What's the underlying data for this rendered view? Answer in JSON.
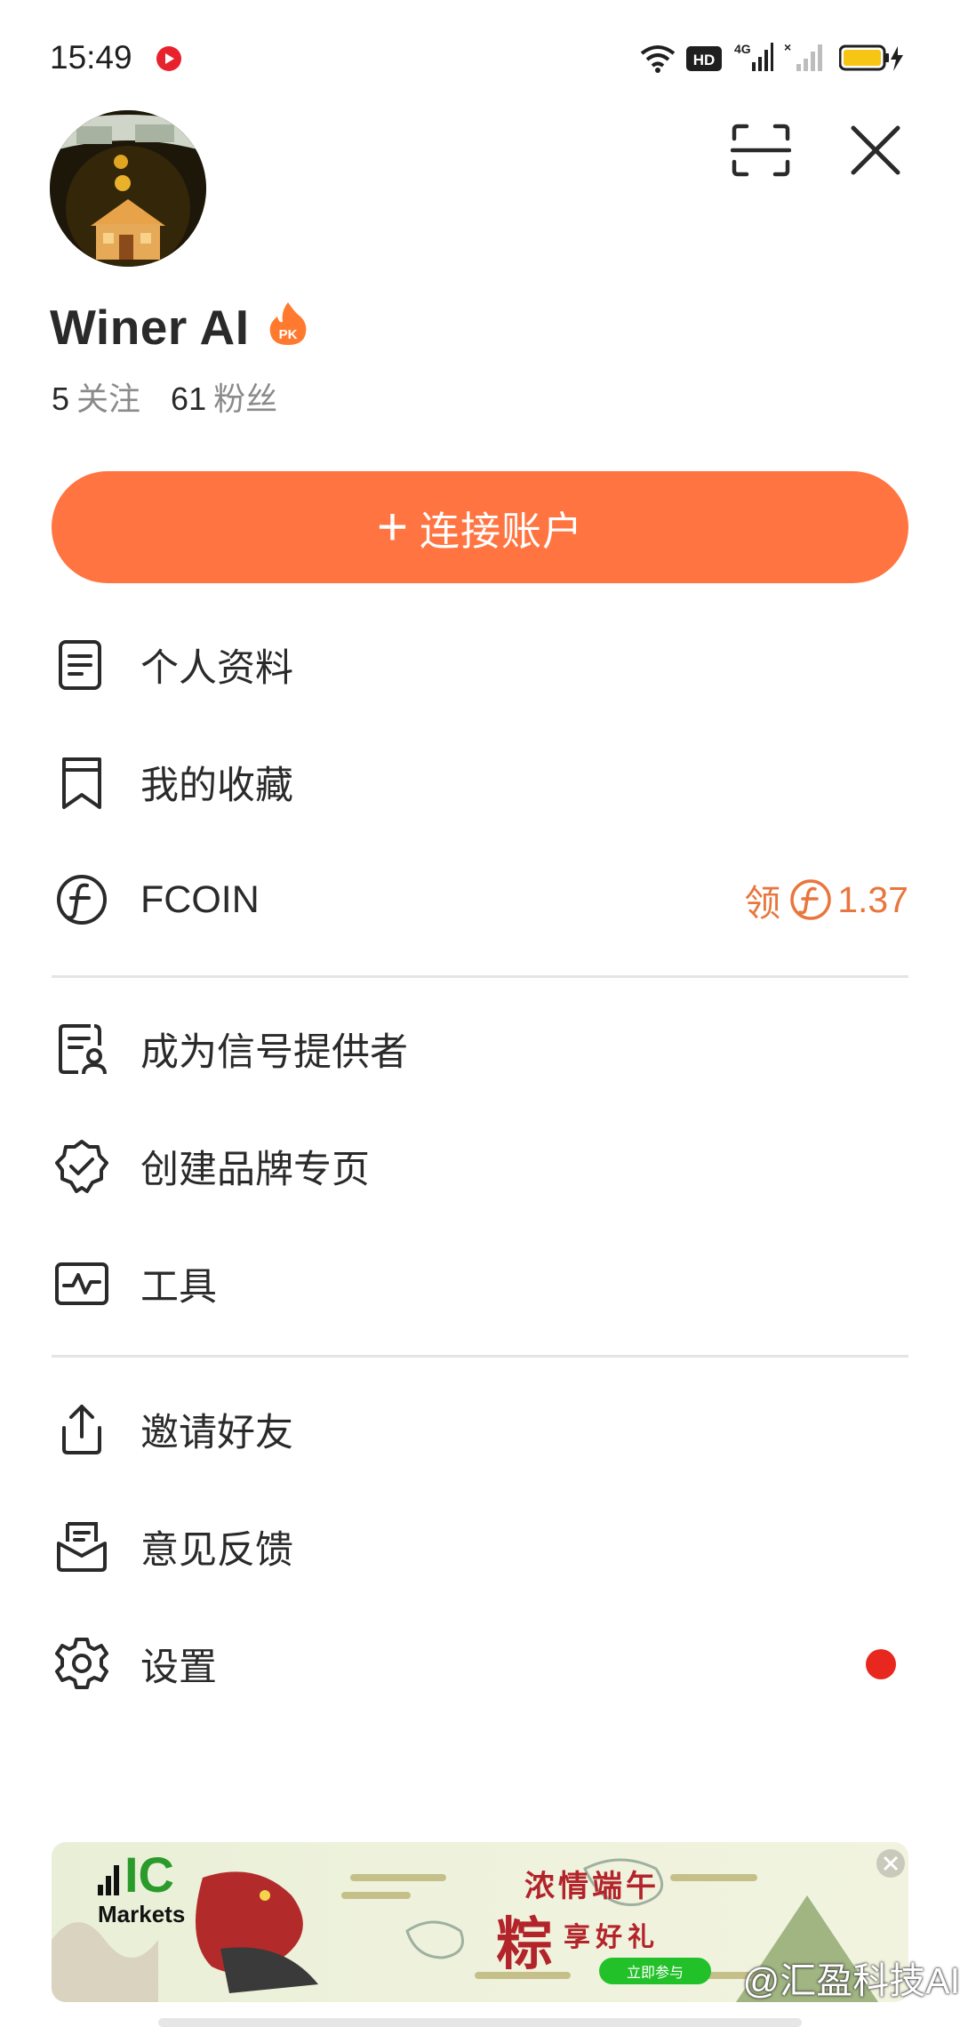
{
  "status_bar": {
    "time": "15:49",
    "battery_color": "#f7c614",
    "network_label": "4G"
  },
  "header": {
    "scan_icon": "scan-icon",
    "close_icon": "close-icon"
  },
  "profile": {
    "avatar_icon": "house-money-avatar",
    "name": "Winer AI",
    "badge_text": "PK",
    "following_count": "5",
    "following_label": "关注",
    "followers_count": "61",
    "followers_label": "粉丝"
  },
  "connect_button": {
    "label": "连接账户",
    "color": "#ff7441"
  },
  "menu": {
    "profile": "个人资料",
    "favorites": "我的收藏",
    "fcoin": "FCOIN",
    "fcoin_claim": "领",
    "fcoin_value": "1.37",
    "signal_provider": "成为信号提供者",
    "brand_page": "创建品牌专页",
    "tools": "工具",
    "invite": "邀请好友",
    "feedback": "意见反馈",
    "settings": "设置"
  },
  "banner": {
    "brand_big": "IC",
    "brand_small": "Markets",
    "title": "浓情端午",
    "big_char": "粽",
    "subtitle": "享好礼",
    "cta": "立即参与"
  },
  "watermark": "@汇盈科技AI"
}
